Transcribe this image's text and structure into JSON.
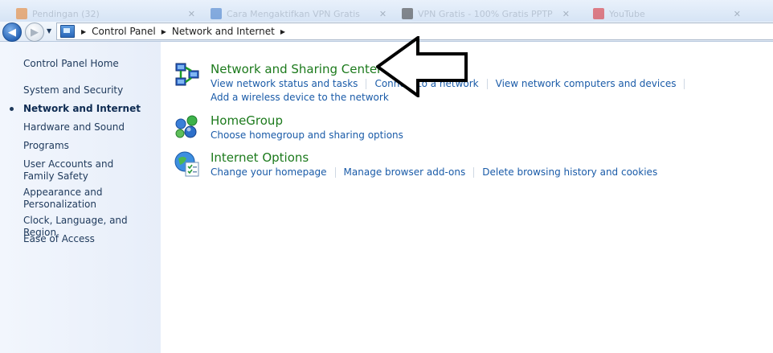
{
  "tabs": [
    {
      "label": "Pendingan (32)",
      "color": "#e87b1e"
    },
    {
      "label": "Cara Mengaktifkan VPN Gratis",
      "color": "#3a77c9"
    },
    {
      "label": "VPN Gratis - 100% Gratis PPTP",
      "color": "#333333"
    },
    {
      "label": "YouTube",
      "color": "#d8222a"
    }
  ],
  "breadcrumb": {
    "items": [
      "Control Panel",
      "Network and Internet"
    ],
    "separator": "▶"
  },
  "sidebar": {
    "items": [
      {
        "label": "Control Panel Home",
        "active": false
      },
      {
        "label": "System and Security",
        "active": false
      },
      {
        "label": "Network and Internet",
        "active": true
      },
      {
        "label": "Hardware and Sound",
        "active": false
      },
      {
        "label": "Programs",
        "active": false
      },
      {
        "label": "User Accounts and Family Safety",
        "active": false
      },
      {
        "label": "Appearance and Personalization",
        "active": false
      },
      {
        "label": "Clock, Language, and Region",
        "active": false
      },
      {
        "label": "Ease of Access",
        "active": false
      }
    ]
  },
  "categories": [
    {
      "title": "Network and Sharing Center",
      "icon": "network-sharing-icon",
      "links": [
        [
          "View network status and tasks",
          "Connect to a network",
          "View network computers and devices"
        ],
        [
          "Add a wireless device to the network"
        ]
      ]
    },
    {
      "title": "HomeGroup",
      "icon": "homegroup-icon",
      "links": [
        [
          "Choose homegroup and sharing options"
        ]
      ]
    },
    {
      "title": "Internet Options",
      "icon": "internet-options-icon",
      "links": [
        [
          "Change your homepage",
          "Manage browser add-ons",
          "Delete browsing history and cookies"
        ]
      ]
    }
  ],
  "colors": {
    "category_title": "#1c7a1c",
    "link": "#1a5ba8",
    "sidebar_bg": "#eaf0fa"
  }
}
